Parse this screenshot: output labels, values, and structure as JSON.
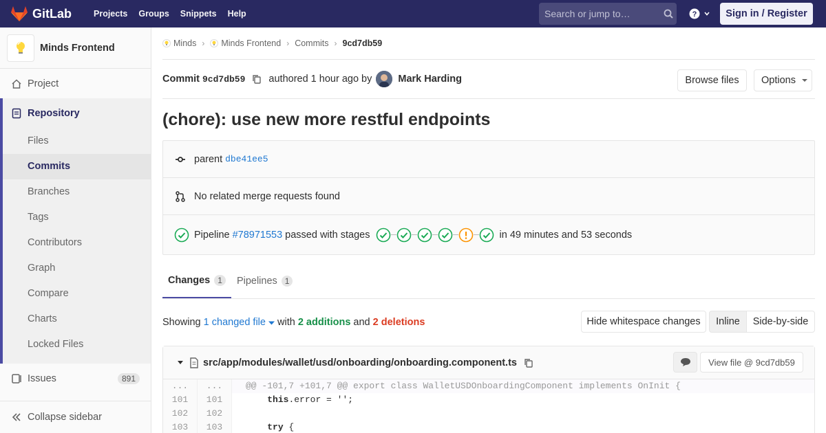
{
  "navbar": {
    "brand": "GitLab",
    "links": [
      "Projects",
      "Groups",
      "Snippets",
      "Help"
    ],
    "search_placeholder": "Search or jump to…",
    "signin": "Sign in / Register"
  },
  "sidebar": {
    "project_name": "Minds Frontend",
    "project": "Project",
    "repository": "Repository",
    "repo_items": [
      "Files",
      "Commits",
      "Branches",
      "Tags",
      "Contributors",
      "Graph",
      "Compare",
      "Charts",
      "Locked Files"
    ],
    "issues": "Issues",
    "issues_count": "891",
    "collapse": "Collapse sidebar"
  },
  "breadcrumb": {
    "items": [
      "Minds",
      "Minds Frontend",
      "Commits"
    ],
    "current": "9cd7db59"
  },
  "commit": {
    "label": "Commit",
    "sha": "9cd7db59",
    "authored": "authored 1 hour ago by",
    "author": "Mark Harding",
    "browse_files": "Browse files",
    "options": "Options",
    "title": "(chore): use new more restful endpoints",
    "parent_label": "parent",
    "parent_sha": "dbe41ee5",
    "merge_requests": "No related merge requests found",
    "pipeline_label": "Pipeline",
    "pipeline_id": "#78971553",
    "pipeline_status": "passed with stages",
    "pipeline_duration": "in 49 minutes and 53 seconds",
    "stages": [
      "success",
      "success",
      "success",
      "success",
      "warning",
      "success"
    ]
  },
  "tabs": [
    {
      "label": "Changes",
      "count": "1"
    },
    {
      "label": "Pipelines",
      "count": "1"
    }
  ],
  "summary": {
    "showing": "Showing",
    "changed_files": "1 changed file",
    "with": "with",
    "additions": "2 additions",
    "and": "and",
    "deletions": "2 deletions",
    "hide_whitespace": "Hide whitespace changes",
    "inline": "Inline",
    "side_by_side": "Side-by-side"
  },
  "file": {
    "path": "src/app/modules/wallet/usd/onboarding/onboarding.component.ts",
    "view_file": "View file @ 9cd7db59",
    "hunk": "@@ -101,7 +101,7 @@ export class WalletUSDOnboardingComponent implements OnInit {",
    "lines": [
      {
        "old": "101",
        "new": "101",
        "code": "    this.error = '';"
      },
      {
        "old": "102",
        "new": "102",
        "code": ""
      },
      {
        "old": "103",
        "new": "103",
        "code": "    try {"
      }
    ]
  },
  "colors": {
    "navbar": "#292961",
    "accent": "#4b4ba3",
    "link": "#1f78d1",
    "success": "#1aaa55",
    "warning": "#fc9403"
  }
}
